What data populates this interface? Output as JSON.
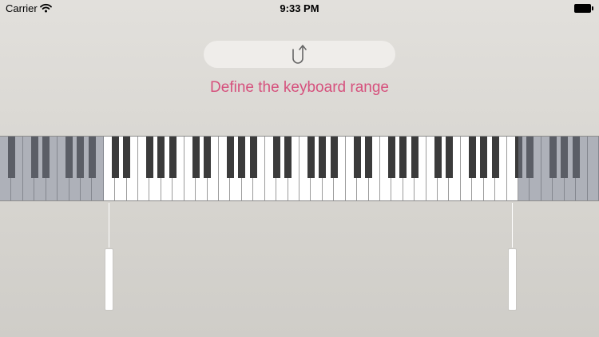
{
  "status_bar": {
    "carrier": "Carrier",
    "time": "9:33 PM",
    "wifi_icon": "wifi-icon",
    "battery_icon": "battery-icon"
  },
  "undo_button": {
    "icon": "undo-arrow-icon"
  },
  "prompt": "Define the keyboard range",
  "colors": {
    "prompt": "#d6517d",
    "selected_white_key": "#ffffff",
    "unselected_key_shade": "#8d929f",
    "black_key": "#3b3b3b"
  },
  "keyboard": {
    "white_key_count": 52,
    "selected_range": {
      "start_white_key_index": 9,
      "end_white_key_index": 44
    }
  }
}
